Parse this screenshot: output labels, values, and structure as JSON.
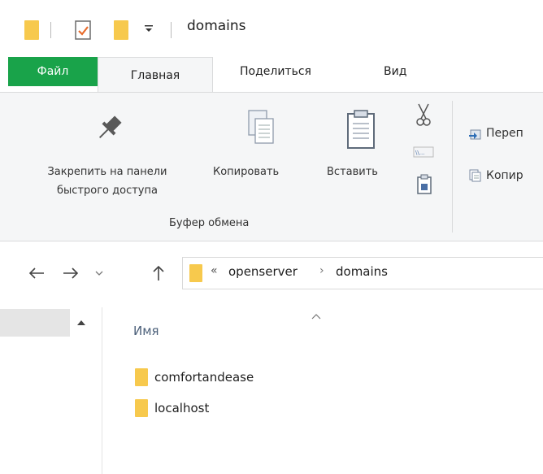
{
  "title": "domains",
  "tabs": [
    "Файл",
    "Главная",
    "Поделиться",
    "Вид"
  ],
  "ribbon": {
    "pin_label": "Закрепить на панели быстрого доступа",
    "pin_label_line1": "Закрепить на панели",
    "pin_label_line2": "быстрого доступа",
    "copy_label": "Копировать",
    "paste_label": "Вставить",
    "move_label": "Переп",
    "copyto_label": "Копир",
    "group_clipboard": "Буфер обмена"
  },
  "nav": {
    "breadcrumb_overflow": "«",
    "path": [
      "openserver",
      "domains"
    ],
    "separator": "›"
  },
  "columns": {
    "name_header": "Имя"
  },
  "files": [
    {
      "name": "comfortandease",
      "icon": "folder-icon"
    },
    {
      "name": "localhost",
      "icon": "folder-icon"
    }
  ],
  "colors": {
    "file_tab": "#19a34a",
    "folder": "#f7c94d",
    "ribbon_bg": "#f5f6f7"
  }
}
